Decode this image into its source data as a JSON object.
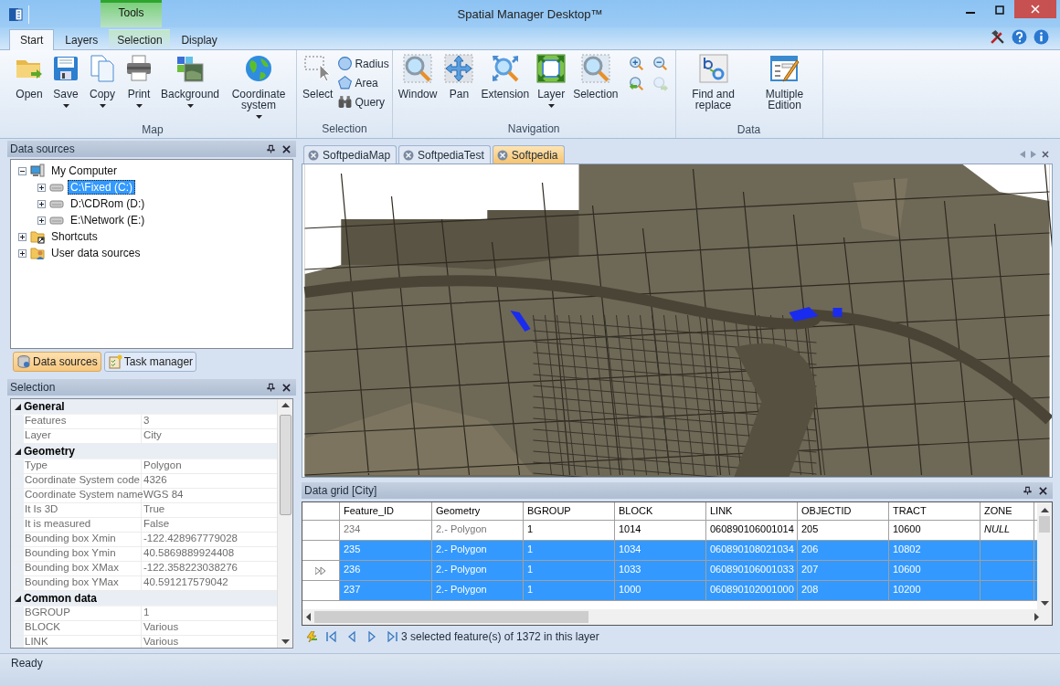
{
  "window": {
    "title": "Spatial Manager Desktop™",
    "context_label": "Tools"
  },
  "ribbon": {
    "tabs": [
      {
        "label": "Start",
        "selected": true,
        "kind": "normal"
      },
      {
        "label": "Layers",
        "selected": false,
        "kind": "normal"
      },
      {
        "label": "Selection",
        "selected": false,
        "kind": "context"
      },
      {
        "label": "Display",
        "selected": false,
        "kind": "normal"
      }
    ],
    "groups": [
      {
        "label": "Map",
        "buttons": [
          {
            "label": "Open",
            "kind": "large",
            "dropdown": false
          },
          {
            "label": "Save",
            "kind": "large",
            "dropdown": true
          },
          {
            "label": "Copy",
            "kind": "large",
            "dropdown": true
          },
          {
            "label": "Print",
            "kind": "large",
            "dropdown": true
          },
          {
            "label": "Background",
            "kind": "large",
            "dropdown": true
          },
          {
            "label": "Coordinate system",
            "kind": "large",
            "dropdown": true
          }
        ]
      },
      {
        "label": "Selection",
        "buttons": [
          {
            "label": "Select",
            "kind": "large",
            "dropdown": false
          },
          {
            "label": "Radius",
            "kind": "small",
            "dropdown": false
          },
          {
            "label": "Area",
            "kind": "small",
            "dropdown": false
          },
          {
            "label": "Query",
            "kind": "small",
            "dropdown": false
          }
        ]
      },
      {
        "label": "Navigation",
        "buttons": [
          {
            "label": "Window",
            "kind": "large",
            "dropdown": false
          },
          {
            "label": "Pan",
            "kind": "large",
            "dropdown": false
          },
          {
            "label": "Extension",
            "kind": "large",
            "dropdown": false
          },
          {
            "label": "Layer",
            "kind": "large",
            "dropdown": true
          },
          {
            "label": "Selection",
            "kind": "large",
            "dropdown": false
          }
        ],
        "zoom_tools": [
          {
            "disabled": false
          },
          {
            "disabled": false
          },
          {
            "disabled": false
          },
          {
            "disabled": true
          }
        ]
      },
      {
        "label": "Data",
        "buttons": [
          {
            "label": "Find and replace",
            "kind": "large",
            "dropdown": false
          },
          {
            "label": "Multiple Edition",
            "kind": "large",
            "dropdown": false
          }
        ]
      }
    ]
  },
  "data_sources": {
    "title": "Data sources",
    "tree": [
      {
        "label": "My Computer",
        "expanded": true,
        "selected": false,
        "children": [
          {
            "label": "C:\\Fixed (C:)",
            "expanded": false,
            "selected": true
          },
          {
            "label": "D:\\CDRom (D:)",
            "expanded": false,
            "selected": false
          },
          {
            "label": "E:\\Network (E:)",
            "expanded": false,
            "selected": false
          }
        ]
      },
      {
        "label": "Shortcuts",
        "expanded": false,
        "selected": false
      },
      {
        "label": "User data sources",
        "expanded": false,
        "selected": false
      }
    ],
    "tabs": [
      {
        "label": "Data sources",
        "selected": true
      },
      {
        "label": "Task manager",
        "selected": false
      }
    ]
  },
  "selection_panel": {
    "title": "Selection",
    "categories": [
      {
        "label": "General",
        "expanded": true,
        "rows": [
          [
            "Features",
            "3"
          ],
          [
            "Layer",
            "City"
          ]
        ]
      },
      {
        "label": "Geometry",
        "expanded": true,
        "rows": [
          [
            "Type",
            "Polygon"
          ],
          [
            "Coordinate System code",
            "4326"
          ],
          [
            "Coordinate System name",
            "WGS 84"
          ],
          [
            "It Is 3D",
            "True"
          ],
          [
            "It is measured",
            "False"
          ],
          [
            "Bounding box Xmin",
            "-122.428967779028"
          ],
          [
            "Bounding box Ymin",
            "40.5869889924408"
          ],
          [
            "Bounding box XMax",
            "-122.358223038276"
          ],
          [
            "Bounding box YMax",
            "40.591217579042"
          ]
        ]
      },
      {
        "label": "Common data",
        "expanded": true,
        "rows": [
          [
            "BGROUP",
            "1"
          ],
          [
            "BLOCK",
            "Various"
          ],
          [
            "LINK",
            "Various"
          ]
        ]
      }
    ]
  },
  "documents": {
    "tabs": [
      {
        "label": "SoftpediaMap",
        "selected": false
      },
      {
        "label": "SoftpediaTest",
        "selected": false
      },
      {
        "label": "Softpedia",
        "selected": true
      }
    ]
  },
  "data_grid": {
    "title": "Data grid [City]",
    "columns": [
      "Feature_ID",
      "Geometry",
      "BGROUP",
      "BLOCK",
      "LINK",
      "OBJECTID",
      "TRACT",
      "ZONE"
    ],
    "rows": [
      {
        "cells": [
          "234",
          "2.- Polygon",
          "1",
          "1014",
          "060890106001014",
          "205",
          "10600",
          "NULL"
        ],
        "selected": false,
        "current": false
      },
      {
        "cells": [
          "235",
          "2.- Polygon",
          "1",
          "1034",
          "060890108021034",
          "206",
          "10802"
        ],
        "selected": true,
        "current": false
      },
      {
        "cells": [
          "236",
          "2.- Polygon",
          "1",
          "1033",
          "060890106001033",
          "207",
          "10600"
        ],
        "selected": true,
        "current": true
      },
      {
        "cells": [
          "237",
          "2.- Polygon",
          "1",
          "1000",
          "060890102001000",
          "208",
          "10200"
        ],
        "selected": true,
        "current": false
      }
    ],
    "status": "3 selected feature(s) of 1372 in this layer"
  },
  "status_bar": {
    "text": "Ready"
  }
}
